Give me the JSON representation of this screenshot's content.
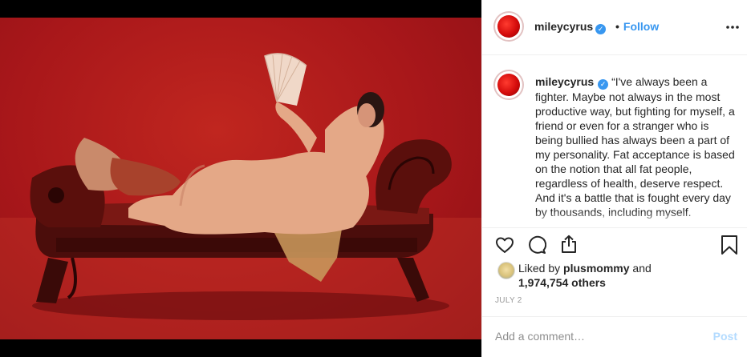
{
  "post": {
    "username": "mileycyrus",
    "verified_glyph": "✓",
    "separator": "•",
    "follow_label": "Follow",
    "more_label": "•••",
    "caption": "“I've always been a fighter. Maybe not always in the most productive way, but fighting for myself, a friend or even for a stranger who is being bullied has always been a part of my personality. Fat acceptance is based on the notion that all fat people, regardless of health, deserve respect. And it's a battle that is fought every day by thousands, including myself.",
    "likes_prefix": "Liked by ",
    "liked_by_user": "plusmommy",
    "likes_and": " and",
    "likes_count": "1,974,754 others",
    "date": "JULY 2",
    "comment_placeholder": "Add a comment…",
    "post_label": "Post"
  },
  "icons": {
    "like": "heart-icon",
    "comment": "comment-icon",
    "share": "share-icon",
    "save": "bookmark-icon",
    "more": "ellipsis-icon"
  },
  "colors": {
    "link_blue": "#3897f0",
    "post_disabled": "#b3dbff",
    "photo_red": "#a8171a"
  }
}
